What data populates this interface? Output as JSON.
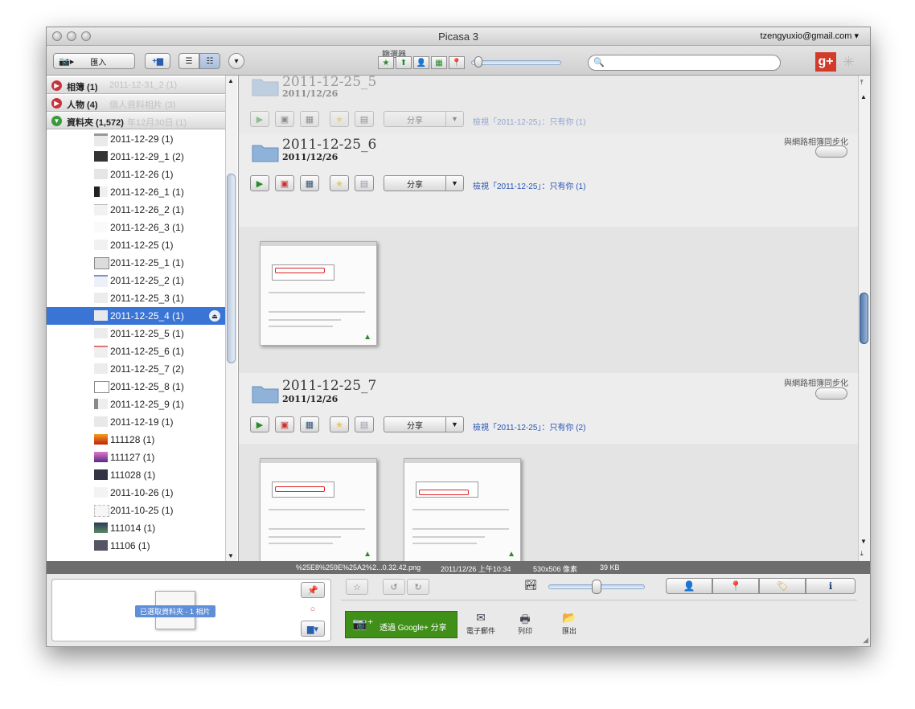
{
  "window": {
    "title": "Picasa 3",
    "account": "tzengyuxio@gmail.com ▾"
  },
  "toolbar": {
    "import_label": "匯入",
    "filter_label": "篩選器",
    "search_placeholder": "",
    "gplus_label": "g+"
  },
  "sidebar": {
    "categories": [
      {
        "name": "相簿 (1)",
        "ghost": "2011-12-31_2 (1)"
      },
      {
        "name": "人物 (4)",
        "ghost": "個人資料相片 (3)"
      },
      {
        "name": "資料夾 (1,572)",
        "ghost": "年12月30日 (1)"
      }
    ],
    "folders": [
      "2011-12-29 (1)",
      "2011-12-29_1 (2)",
      "2011-12-26 (1)",
      "2011-12-26_1 (1)",
      "2011-12-26_2 (1)",
      "2011-12-26_3 (1)",
      "2011-12-25 (1)",
      "2011-12-25_1 (1)",
      "2011-12-25_2 (1)",
      "2011-12-25_3 (1)",
      "2011-12-25_4 (1)",
      "2011-12-25_5 (1)",
      "2011-12-25_6 (1)",
      "2011-12-25_7 (2)",
      "2011-12-25_8 (1)",
      "2011-12-25_9 (1)",
      "2011-12-19 (1)",
      "111128 (1)",
      "111127 (1)",
      "111028 (1)",
      "2011-10-26 (1)",
      "2011-10-25 (1)",
      "111014 (1)",
      "11106 (1)"
    ],
    "selected_index": 10
  },
  "albums": [
    {
      "title": "2011-12-25_5",
      "date": "2011/12/26",
      "share": "分享",
      "view_link": "檢視「2011-12-25」：只有你 (1)"
    },
    {
      "title": "2011-12-25_6",
      "date": "2011/12/26",
      "sync_label": "與網路相簿同步化",
      "share": "分享",
      "view_link": "檢視「2011-12-25」：只有你 (1)"
    },
    {
      "title": "2011-12-25_7",
      "date": "2011/12/26",
      "sync_label": "與網路相簿同步化",
      "share": "分享",
      "view_link": "檢視「2011-12-25」：只有你 (2)"
    }
  ],
  "status": {
    "filename": "%25E8%259E%25A2%2...0.32.42.png",
    "datetime": "2011/12/26 上午10:34",
    "dimensions": "530x506 像素",
    "size": "39 KB"
  },
  "bottom": {
    "tray_label": "已選取資料夾 - 1 相片",
    "gshare_label": "透過 Google+ 分享",
    "email_label": "電子郵件",
    "print_label": "列印",
    "export_label": "匯出"
  },
  "colors": {
    "selection": "#3a75d6",
    "gshare": "#3f8f19",
    "link": "#2b55b5",
    "gplus": "#d33a2a"
  }
}
